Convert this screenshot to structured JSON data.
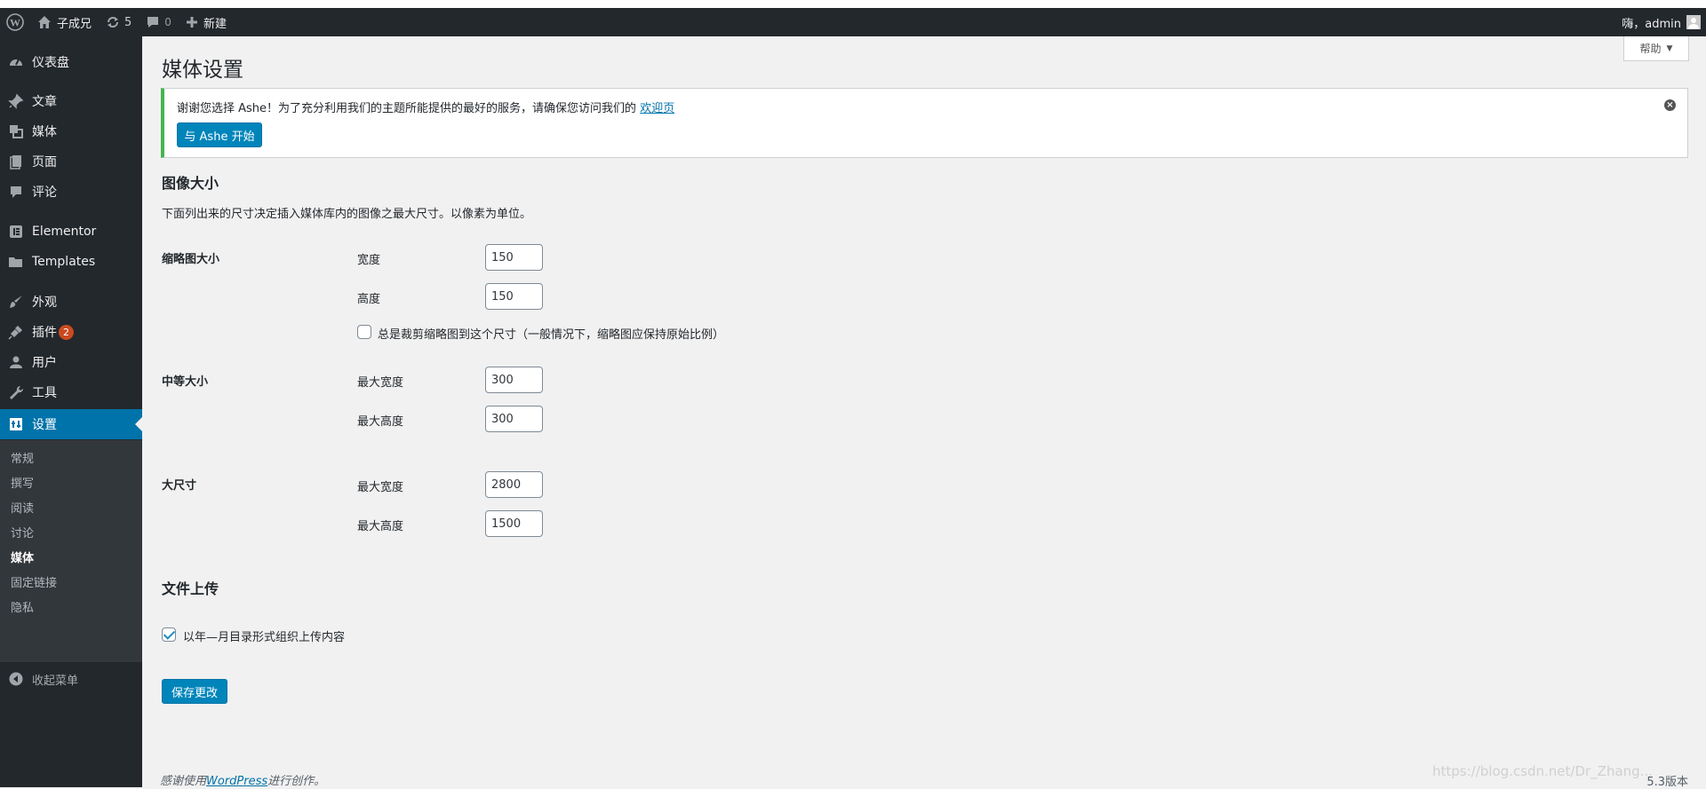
{
  "admin_bar": {
    "site_name": "子成兄",
    "updates_count": "5",
    "comments_count": "0",
    "new_label": "新建",
    "greeting": "嗨，admin"
  },
  "sidebar": {
    "items": [
      {
        "label": "仪表盘",
        "icon": "dashboard-icon"
      },
      {
        "label": "文章",
        "icon": "pin-icon"
      },
      {
        "label": "媒体",
        "icon": "media-icon"
      },
      {
        "label": "页面",
        "icon": "page-icon"
      },
      {
        "label": "评论",
        "icon": "comment-icon"
      },
      {
        "label": "Elementor",
        "icon": "elementor-icon"
      },
      {
        "label": "Templates",
        "icon": "folder-icon"
      },
      {
        "label": "外观",
        "icon": "brush-icon"
      },
      {
        "label": "插件",
        "icon": "plugin-icon",
        "badge": "2"
      },
      {
        "label": "用户",
        "icon": "user-icon"
      },
      {
        "label": "工具",
        "icon": "wrench-icon"
      },
      {
        "label": "设置",
        "icon": "settings-icon"
      }
    ],
    "submenu": [
      "常规",
      "撰写",
      "阅读",
      "讨论",
      "媒体",
      "固定链接",
      "隐私"
    ],
    "collapse_label": "收起菜单"
  },
  "help_tab": "帮助",
  "page_title": "媒体设置",
  "notice": {
    "text": "谢谢您选择 Ashe！为了充分利用我们的主题所能提供的最好的服务，请确保您访问我们的",
    "link": "欢迎页",
    "button": "与 Ashe 开始"
  },
  "image_sizes": {
    "heading": "图像大小",
    "description": "下面列出来的尺寸决定插入媒体库内的图像之最大尺寸。以像素为单位。",
    "thumbnail": {
      "label": "缩略图大小",
      "width_label": "宽度",
      "width": "150",
      "height_label": "高度",
      "height": "150",
      "crop_label": "总是裁剪缩略图到这个尺寸（一般情况下，缩略图应保持原始比例）",
      "crop_checked": false
    },
    "medium": {
      "label": "中等大小",
      "width_label": "最大宽度",
      "width": "300",
      "height_label": "最大高度",
      "height": "300"
    },
    "large": {
      "label": "大尺寸",
      "width_label": "最大宽度",
      "width": "2800",
      "height_label": "最大高度",
      "height": "1500"
    }
  },
  "uploads": {
    "heading": "文件上传",
    "organize_label": "以年—月目录形式组织上传内容",
    "organize_checked": true
  },
  "save_button": "保存更改",
  "footer": {
    "prefix": "感谢使用",
    "link": "WordPress",
    "suffix": "进行创作。",
    "version": "5.3版本"
  },
  "watermark": "https://blog.csdn.net/Dr_Zhang..."
}
